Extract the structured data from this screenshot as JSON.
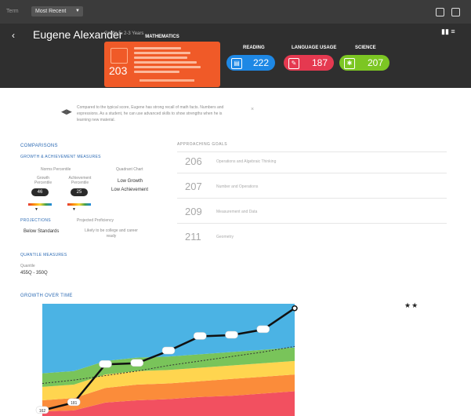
{
  "topbar": {
    "term_label": "Term",
    "term_value": "Most Recent"
  },
  "student": {
    "name": "Eugene Alexander",
    "grade": "Grade 5, 2-3 Years"
  },
  "math": {
    "label": "MATHEMATICS",
    "score": "203"
  },
  "subjects": [
    {
      "label": "READING",
      "score": "222",
      "color": "#1e88e5",
      "icon": "book-icon"
    },
    {
      "label": "LANGUAGE USAGE",
      "score": "187",
      "color": "#e53950",
      "icon": "pencil-icon"
    },
    {
      "label": "SCIENCE",
      "score": "207",
      "color": "#7cc623",
      "icon": "atom-icon"
    }
  ],
  "info": {
    "text": "Compared to the typical score, Eugene has strong recall of math facts. Numbers and expressions. As a student, he can use advanced skills to show strengths when he is learning new material."
  },
  "comparisons": {
    "title": "COMPARISONS",
    "growth_title": "GROWTH & ACHIEVEMENT MEASURES",
    "norms_label": "Norms Percentile",
    "quadrant_label": "Quadrant Chart",
    "growth_col": "Growth Percentile",
    "achievement_col": "Achievement Percentile",
    "growth_pct": "46",
    "achievement_pct": "25",
    "low_growth": "Low Growth",
    "low_achievement": "Low Achievement",
    "projections_title": "PROJECTIONS",
    "projections_sub": "Projected Proficiency",
    "below_standards": "Below Standards",
    "college_text": "Likely to be college and career ready",
    "quantile_title": "QUANTILE MEASURES",
    "quantile_label": "Quantile",
    "quantile_value": "455Q - 350Q"
  },
  "approaching": {
    "title": "APPROACHING GOALS",
    "rows": [
      {
        "score": "206",
        "label": "Operations and Algebraic Thinking"
      },
      {
        "score": "207",
        "label": "Number and Operations"
      },
      {
        "score": "209",
        "label": "Measurement and Data"
      },
      {
        "score": "211",
        "label": "Geometry"
      }
    ]
  },
  "growth": {
    "title": "GROWTH OVER TIME"
  },
  "chart_data": {
    "type": "area",
    "x": [
      1,
      2,
      3,
      4,
      5,
      6,
      7,
      8,
      9
    ],
    "bands": [
      {
        "color": "#f25060",
        "values": [
          0.04,
          0.05,
          0.12,
          0.14,
          0.15,
          0.17,
          0.18,
          0.2,
          0.22
        ]
      },
      {
        "color": "#fb8c3a",
        "values": [
          0.1,
          0.11,
          0.13,
          0.14,
          0.14,
          0.14,
          0.15,
          0.15,
          0.15
        ]
      },
      {
        "color": "#ffd54f",
        "values": [
          0.12,
          0.12,
          0.12,
          0.12,
          0.12,
          0.12,
          0.12,
          0.12,
          0.12
        ]
      },
      {
        "color": "#79c45a",
        "values": [
          0.12,
          0.12,
          0.12,
          0.12,
          0.12,
          0.12,
          0.12,
          0.12,
          0.12
        ]
      },
      {
        "color": "#4bb3e4",
        "values": [
          0.62,
          0.6,
          0.51,
          0.48,
          0.47,
          0.45,
          0.43,
          0.41,
          0.39
        ]
      }
    ],
    "dashed": [
      0.29,
      0.32,
      0.36,
      0.4,
      0.45,
      0.49,
      0.53,
      0.57,
      0.62
    ],
    "student": [
      0.05,
      0.12,
      0.46,
      0.47,
      0.58,
      0.71,
      0.72,
      0.77,
      0.96
    ],
    "labels": [
      "162",
      "181",
      "",
      "",
      "",
      "",
      "",
      "",
      ""
    ]
  }
}
